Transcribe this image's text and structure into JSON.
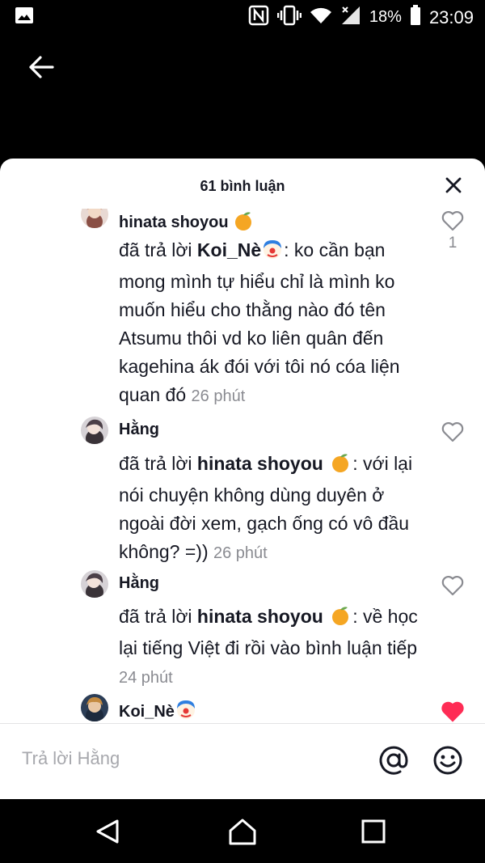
{
  "status_bar": {
    "battery": "18%",
    "time": "23:09"
  },
  "sheet": {
    "title": "61 bình luận"
  },
  "comments": [
    {
      "username": "hinata shoyou",
      "username_emoji": "tangerine",
      "reply_prefix": "đã trả lời ",
      "reply_to": "Koi_Nè",
      "reply_to_emoji": "clown",
      "text": ": ko cần bạn mong mình tự hiểu chỉ là mình ko muốn hiểu cho thằng nào đó tên Atsumu thôi vd ko liên quân đến kagehina ák đói với tôi nó cóa liện quan đó",
      "time": "26 phút",
      "likes": "1",
      "liked": false
    },
    {
      "username": "Hằng",
      "reply_prefix": "đã trả lời ",
      "reply_to": "hinata shoyou",
      "reply_to_emoji": "tangerine",
      "text": ": với lại nói chuyện không dùng duyên ở ngoài đời xem, gạch ống có vô đầu không? =))",
      "time": "26 phút",
      "liked": false
    },
    {
      "username": "Hằng",
      "reply_prefix": "đã trả lời ",
      "reply_to": "hinata shoyou",
      "reply_to_emoji": "tangerine",
      "text": ": về học lại tiếng Việt đi rồi vào bình luận tiếp",
      "time": "24 phút",
      "liked": false
    },
    {
      "username": "Koi_Nè",
      "username_emoji": "clown",
      "liked": true
    }
  ],
  "reply_bar": {
    "placeholder": "Trả lời Hằng"
  },
  "icons": {
    "back": "arrow-left-icon",
    "close": "close-icon",
    "heart": "heart-icon",
    "mention": "at-icon",
    "emoji": "smiley-icon"
  },
  "colors": {
    "liked_heart": "#fe2c55",
    "time_text": "#8a8b91"
  }
}
